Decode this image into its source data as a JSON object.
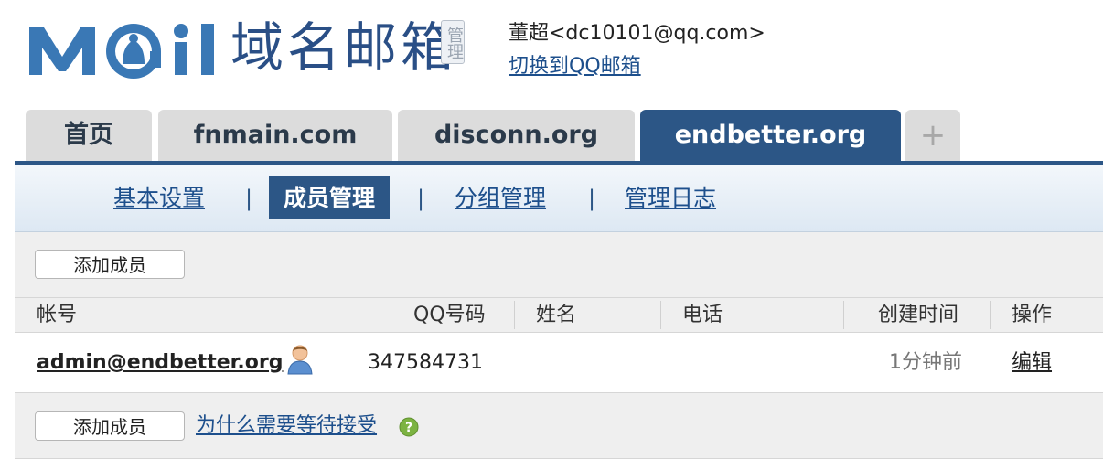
{
  "header": {
    "logo_text": "Mail",
    "domain_title": "域名邮箱",
    "admin_badge": "管理",
    "user": "董超<dc10101@qq.com>",
    "switch_link": "切换到QQ邮箱"
  },
  "tabs": [
    {
      "label": "首页"
    },
    {
      "label": "fnmain.com"
    },
    {
      "label": "disconn.org"
    },
    {
      "label": "endbetter.org",
      "active": true
    },
    {
      "label": "+"
    }
  ],
  "subnav": {
    "items": [
      {
        "label": "基本设置"
      },
      {
        "label": "成员管理",
        "active": true
      },
      {
        "label": "分组管理"
      },
      {
        "label": "管理日志"
      }
    ],
    "separator": "|"
  },
  "toolbar": {
    "add_member": "添加成员"
  },
  "table": {
    "columns": [
      "帐号",
      "QQ号码",
      "姓名",
      "电话",
      "创建时间",
      "操作"
    ],
    "rows": [
      {
        "account": "admin@endbetter.org",
        "qq": "347584731",
        "name": "",
        "phone": "",
        "created": "1分钟前",
        "action": "编辑"
      }
    ]
  },
  "footer": {
    "add_member": "添加成员",
    "help_link": "为什么需要等待接受"
  },
  "colors": {
    "brand_blue": "#2c5686",
    "logo_blue": "#3a78b5",
    "help_green": "#7cb342"
  },
  "icons": [
    "logo-mail",
    "user-icon",
    "help-icon",
    "plus-icon"
  ]
}
